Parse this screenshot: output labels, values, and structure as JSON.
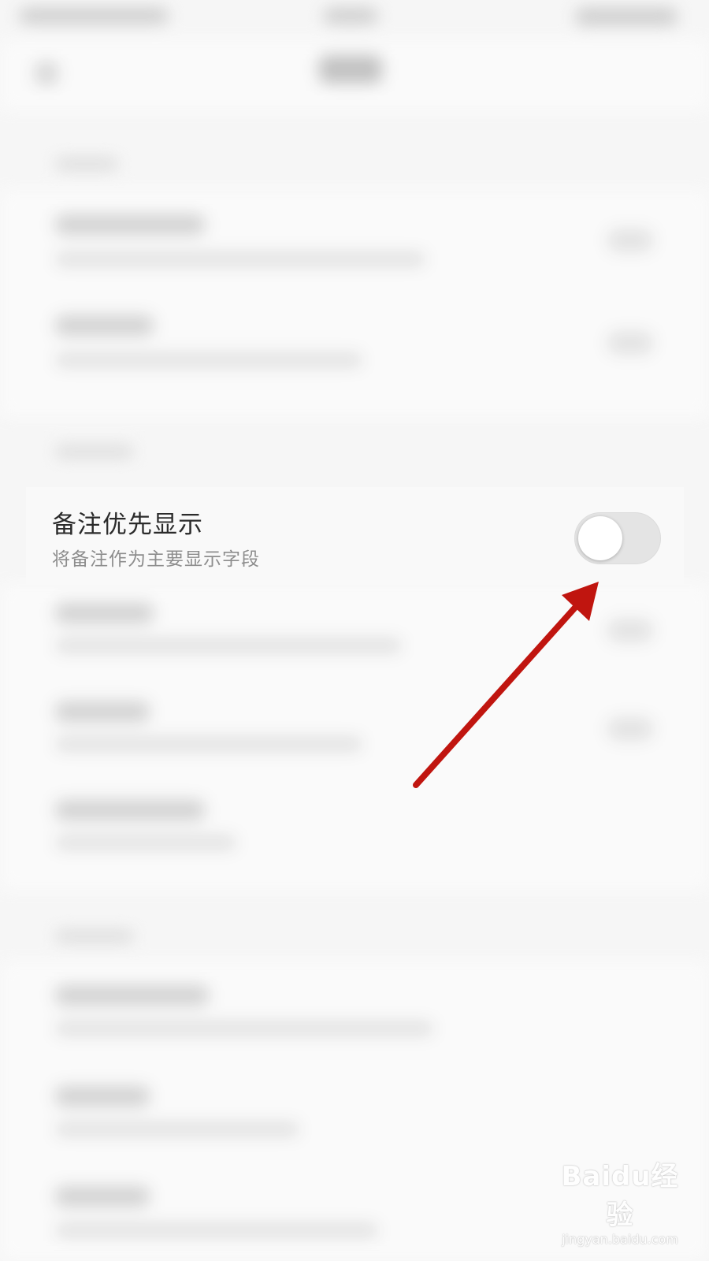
{
  "setting_row": {
    "title": "备注优先显示",
    "subtitle": "将备注作为主要显示字段",
    "toggle_on": false
  },
  "annotation": {
    "arrow_color": "#c0150f"
  },
  "watermark": {
    "main": "Baidu经验",
    "url": "jingyan.baidu.com"
  },
  "colors": {
    "background": "#f6f6f6",
    "title_text": "#2b2b2b",
    "subtitle_text": "#8d8d8d",
    "toggle_off_track": "#e4e4e4"
  }
}
